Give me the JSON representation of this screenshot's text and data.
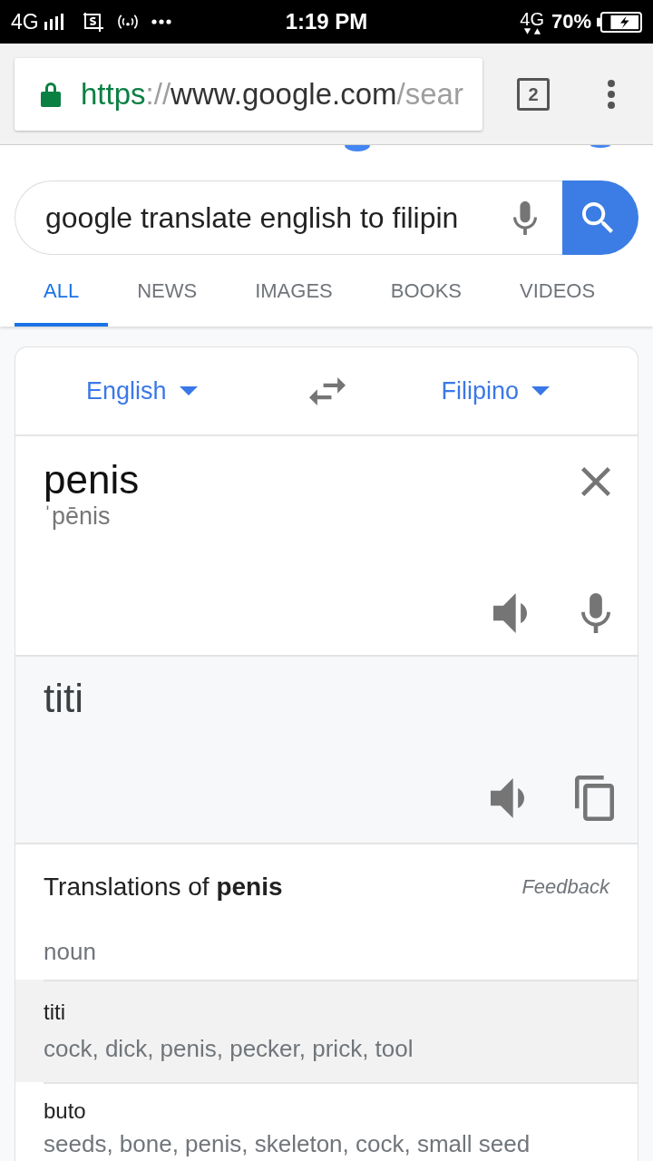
{
  "status_bar": {
    "network_left": "4G",
    "time": "1:19 PM",
    "network_right": "4G",
    "battery": "70%"
  },
  "toolbar": {
    "url": {
      "scheme": "https",
      "separator": "://",
      "host": "www.google.com",
      "path": "/sear"
    },
    "tab_count": "2"
  },
  "search": {
    "query": "google translate english to filipin"
  },
  "tabs": [
    {
      "label": "ALL",
      "selected": true
    },
    {
      "label": "NEWS",
      "selected": false
    },
    {
      "label": "IMAGES",
      "selected": false
    },
    {
      "label": "BOOKS",
      "selected": false
    },
    {
      "label": "VIDEOS",
      "selected": false
    }
  ],
  "translator": {
    "source_language": "English",
    "target_language": "Filipino",
    "source_text": "penis",
    "pronunciation": "ˈpēnis",
    "translation": "titi"
  },
  "translations": {
    "heading": "Translations of **penis**",
    "feedback": "Feedback",
    "part_of_speech": "noun",
    "rows": [
      {
        "word": "titi",
        "synonyms": "cock, dick, penis, pecker, prick, tool",
        "selected": true
      },
      {
        "word": "buto",
        "synonyms": "seeds, bone, penis, skeleton, cock, small seed",
        "selected": false
      }
    ]
  }
}
